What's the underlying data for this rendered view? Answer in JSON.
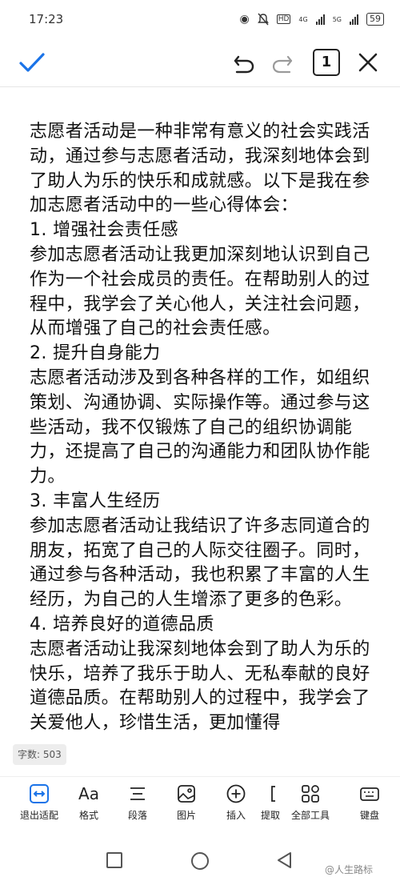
{
  "status": {
    "time": "17:23",
    "hd": "HD",
    "net1": "4G",
    "net2": "5G",
    "battery": "59"
  },
  "toolbar": {
    "page_number": "1"
  },
  "document": {
    "paragraphs": [
      "志愿者活动是一种非常有意义的社会实践活动，通过参与志愿者活动，我深刻地体会到了助人为乐的快乐和成就感。以下是我在参加志愿者活动中的一些心得体会：",
      "1. 增强社会责任感",
      "参加志愿者活动让我更加深刻地认识到自己作为一个社会成员的责任。在帮助别人的过程中，我学会了关心他人，关注社会问题，从而增强了自己的社会责任感。",
      "2. 提升自身能力",
      "志愿者活动涉及到各种各样的工作，如组织策划、沟通协调、实际操作等。通过参与这些活动，我不仅锻炼了自己的组织协调能力，还提高了自己的沟通能力和团队协作能力。",
      "3. 丰富人生经历",
      "参加志愿者活动让我结识了许多志同道合的朋友，拓宽了自己的人际交往圈子。同时，通过参与各种活动，我也积累了丰富的人生经历，为自己的人生增添了更多的色彩。",
      "4. 培养良好的道德品质",
      "志愿者活动让我深刻地体会到了助人为乐的快乐，培养了我乐于助人、无私奉献的良好道德品质。在帮助别人的过程中，我学会了关爱他人，珍惜生活，更加懂得"
    ]
  },
  "word_count": "字数: 503",
  "bottom_toolbar": {
    "exit_fit": "退出适配",
    "format": "格式",
    "paragraph": "段落",
    "picture": "图片",
    "insert": "插入",
    "extract": "提取",
    "all_tools": "全部工具",
    "keyboard": "键盘"
  },
  "watermark": "@人生路标",
  "colors": {
    "accent": "#1a73e8",
    "text": "#111111"
  }
}
